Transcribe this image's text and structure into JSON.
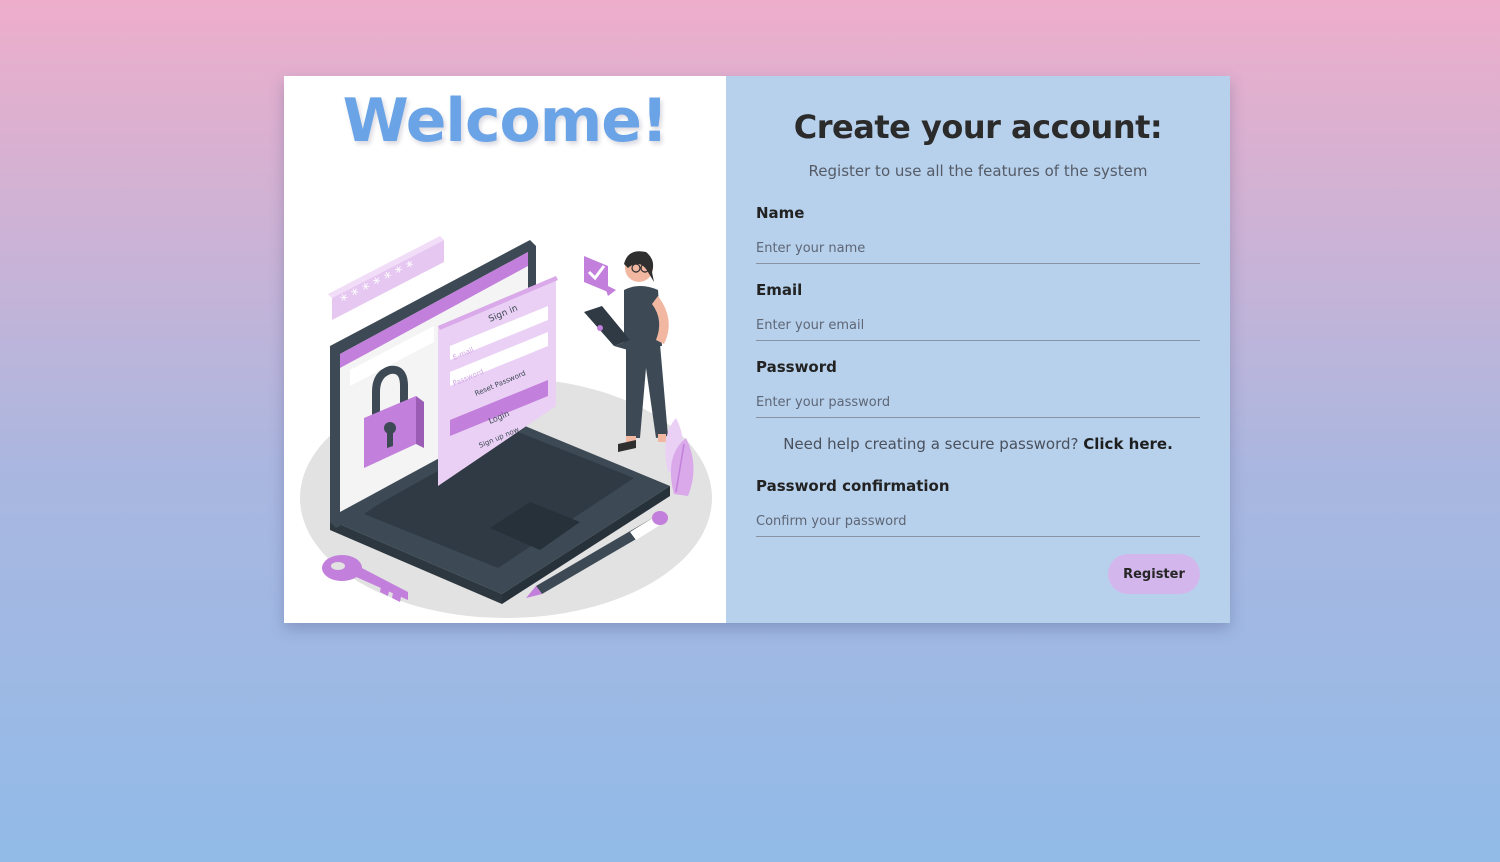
{
  "hero": {
    "title": "Welcome!"
  },
  "illustration": {
    "password_dots": "* * * * * * *",
    "signin_title": "Sign in",
    "email_field": "E-mail",
    "password_field": "Password",
    "reset_label": "Reset Password",
    "login_label": "Login",
    "signup_label": "Sign up now"
  },
  "form": {
    "title": "Create your account:",
    "subtitle": "Register to use all the features of the system",
    "name": {
      "label": "Name",
      "placeholder": "Enter your name"
    },
    "email": {
      "label": "Email",
      "placeholder": "Enter your email"
    },
    "password": {
      "label": "Password",
      "placeholder": "Enter your password"
    },
    "help": {
      "text": "Need help creating a secure password?",
      "link": "Click here."
    },
    "confirm": {
      "label": "Password confirmation",
      "placeholder": "Confirm your password"
    },
    "register_label": "Register"
  },
  "colors": {
    "accent_blue": "#6aa3e6",
    "form_bg": "#b7d1ed",
    "button_bg": "#d3b7ec",
    "illustration_purple": "#c27fdb",
    "laptop_dark": "#3d4a55"
  },
  "icons": [
    "padlock-icon",
    "key-icon",
    "pencil-icon",
    "checkmark-badge-icon",
    "plant-icon"
  ]
}
